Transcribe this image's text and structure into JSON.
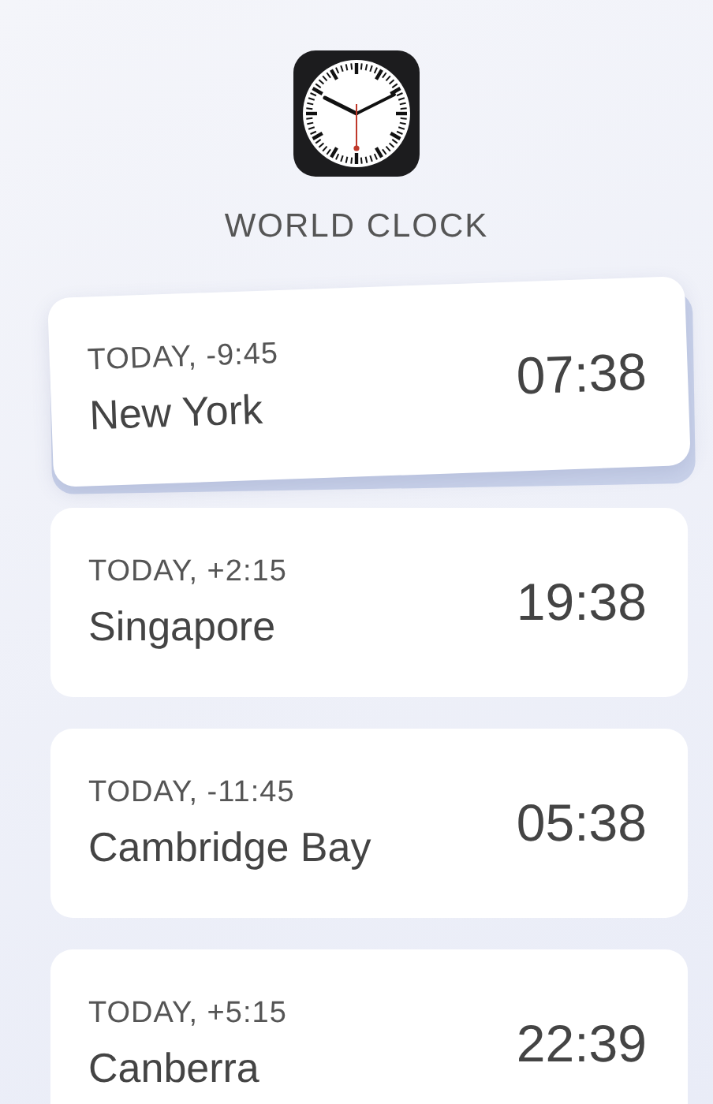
{
  "app": {
    "title": "WORLD CLOCK"
  },
  "clocks": [
    {
      "offset": "TODAY, -9:45",
      "city": "New York",
      "time": "07:38",
      "dragging": true
    },
    {
      "offset": "TODAY, +2:15",
      "city": "Singapore",
      "time": "19:38",
      "dragging": false
    },
    {
      "offset": "TODAY, -11:45",
      "city": "Cambridge Bay",
      "time": "05:38",
      "dragging": false
    },
    {
      "offset": "TODAY, +5:15",
      "city": "Canberra",
      "time": "22:39",
      "dragging": false
    }
  ]
}
